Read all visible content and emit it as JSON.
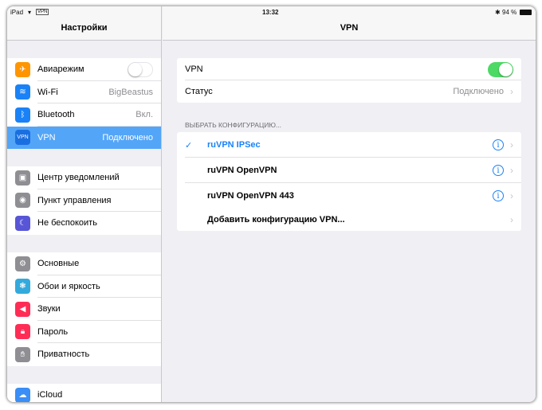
{
  "status_bar": {
    "device": "iPad",
    "vpn_badge": "VPN",
    "time": "13:32",
    "battery": "94 %"
  },
  "sidebar": {
    "title": "Настройки",
    "groups": [
      [
        {
          "label": "Авиарежим",
          "icon": "airplane-icon",
          "color": "#ff9500",
          "toggle": false
        },
        {
          "label": "Wi-Fi",
          "value": "BigBeastus",
          "icon": "wifi-icon",
          "color": "#1a82f7"
        },
        {
          "label": "Bluetooth",
          "value": "Вкл.",
          "icon": "bluetooth-icon",
          "color": "#1a82f7"
        },
        {
          "label": "VPN",
          "value": "Подключено",
          "icon": "vpn-icon",
          "icon_text": "VPN",
          "color": "#1a6fe0",
          "selected": true
        }
      ],
      [
        {
          "label": "Центр уведомлений",
          "icon": "notifications-icon",
          "color": "#8e8e93"
        },
        {
          "label": "Пункт управления",
          "icon": "control-center-icon",
          "color": "#8e8e93"
        },
        {
          "label": "Не беспокоить",
          "icon": "moon-icon",
          "color": "#5856d6"
        }
      ],
      [
        {
          "label": "Основные",
          "icon": "gear-icon",
          "color": "#8e8e93"
        },
        {
          "label": "Обои и яркость",
          "icon": "wallpaper-icon",
          "color": "#34aadc"
        },
        {
          "label": "Звуки",
          "icon": "speaker-icon",
          "color": "#ff2d55"
        },
        {
          "label": "Пароль",
          "icon": "lock-icon",
          "color": "#ff2d55"
        },
        {
          "label": "Приватность",
          "icon": "hand-icon",
          "color": "#8e8e93"
        }
      ],
      [
        {
          "label": "iCloud",
          "icon": "cloud-icon",
          "color": "#3a8ef6"
        }
      ]
    ]
  },
  "main": {
    "title": "VPN",
    "vpn_label": "VPN",
    "vpn_on": true,
    "status_label": "Статус",
    "status_value": "Подключено",
    "section_header": "ВЫБРАТЬ КОНФИГУРАЦИЮ...",
    "configs": [
      {
        "label": "ruVPN IPSec",
        "selected": true
      },
      {
        "label": "ruVPN OpenVPN"
      },
      {
        "label": "ruVPN OpenVPN 443"
      }
    ],
    "add_config": "Добавить конфигурацию VPN..."
  },
  "colors": {
    "accent": "#1a82f7",
    "green": "#4cd964",
    "selected_row": "#53a5f8"
  }
}
